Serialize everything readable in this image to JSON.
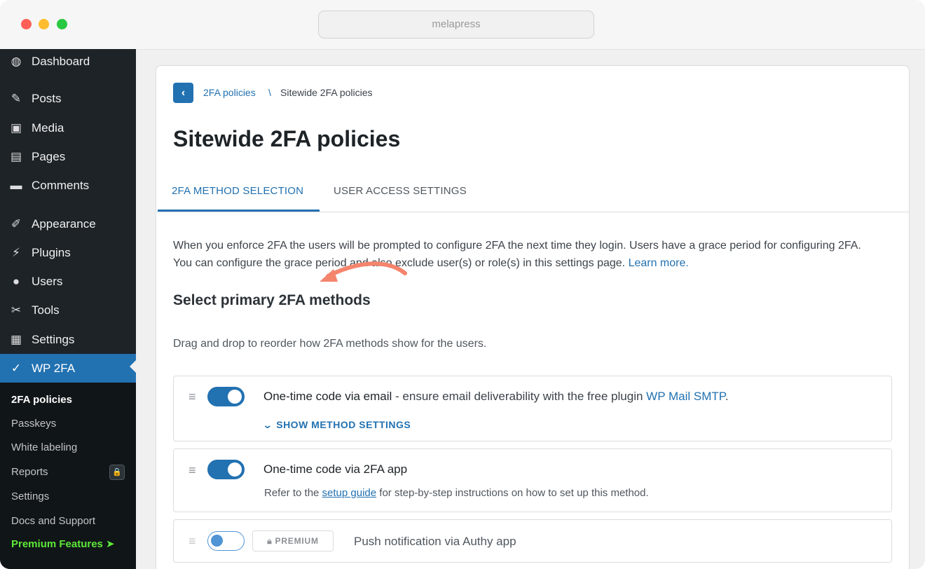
{
  "browser": {
    "url": "melapress"
  },
  "sidebar": {
    "menu": [
      {
        "label": "Dashboard",
        "icon": "dashboard-icon",
        "glyph": "◍"
      },
      {
        "label": "Posts",
        "icon": "pin-icon",
        "glyph": "✎"
      },
      {
        "label": "Media",
        "icon": "media-icon",
        "glyph": "▣"
      },
      {
        "label": "Pages",
        "icon": "pages-icon",
        "glyph": "▤"
      },
      {
        "label": "Comments",
        "icon": "comments-icon",
        "glyph": "▬"
      },
      {
        "label": "Appearance",
        "icon": "brush-icon",
        "glyph": "✐"
      },
      {
        "label": "Plugins",
        "icon": "plug-icon",
        "glyph": "⚡"
      },
      {
        "label": "Users",
        "icon": "user-icon",
        "glyph": "●"
      },
      {
        "label": "Tools",
        "icon": "wrench-icon",
        "glyph": "✂"
      },
      {
        "label": "Settings",
        "icon": "settings-icon",
        "glyph": "▦"
      },
      {
        "label": "WP 2FA",
        "icon": "wp2fa-icon",
        "glyph": "✓"
      }
    ],
    "submenu": [
      {
        "label": "2FA policies"
      },
      {
        "label": "Passkeys"
      },
      {
        "label": "White labeling"
      },
      {
        "label": "Reports"
      },
      {
        "label": "Settings"
      },
      {
        "label": "Docs and Support"
      },
      {
        "label": "Premium Features ➤"
      }
    ]
  },
  "breadcrumb": {
    "parent": "2FA policies",
    "separator": "\\",
    "current": "Sitewide 2FA policies"
  },
  "page": {
    "title": "Sitewide 2FA policies",
    "tabs": [
      {
        "label": "2FA METHOD SELECTION"
      },
      {
        "label": "USER ACCESS SETTINGS"
      }
    ],
    "intro_line1": "When you enforce 2FA the users will be prompted to configure 2FA the next time they login. Users have a grace period for configuring 2FA.",
    "intro_line2": "You can configure the grace period and also exclude user(s) or role(s) in this settings page.",
    "intro_link": "Learn more.",
    "section_title": "Select primary 2FA methods",
    "drag_text": "Drag and drop to reorder how 2FA methods show for the users."
  },
  "methods": [
    {
      "title": "One-time code via email",
      "note": " - ensure email deliverability with the free plugin ",
      "note_link": "WP Mail SMTP",
      "note_end": ".",
      "settings_label": "SHOW METHOD SETTINGS",
      "enabled": true
    },
    {
      "title": "One-time code via 2FA app",
      "desc_prefix": "Refer to the ",
      "desc_link": "setup guide",
      "desc_suffix": " for step-by-step instructions on how to set up this method.",
      "enabled": true
    },
    {
      "title": "Push notification via Authy app",
      "badge": "PREMIUM",
      "enabled": false
    }
  ],
  "colors": {
    "accent": "#2271b1",
    "sidebar_bg": "#1d2327",
    "premium_green": "#5ee83a",
    "annotation_arrow": "#f4846c"
  }
}
